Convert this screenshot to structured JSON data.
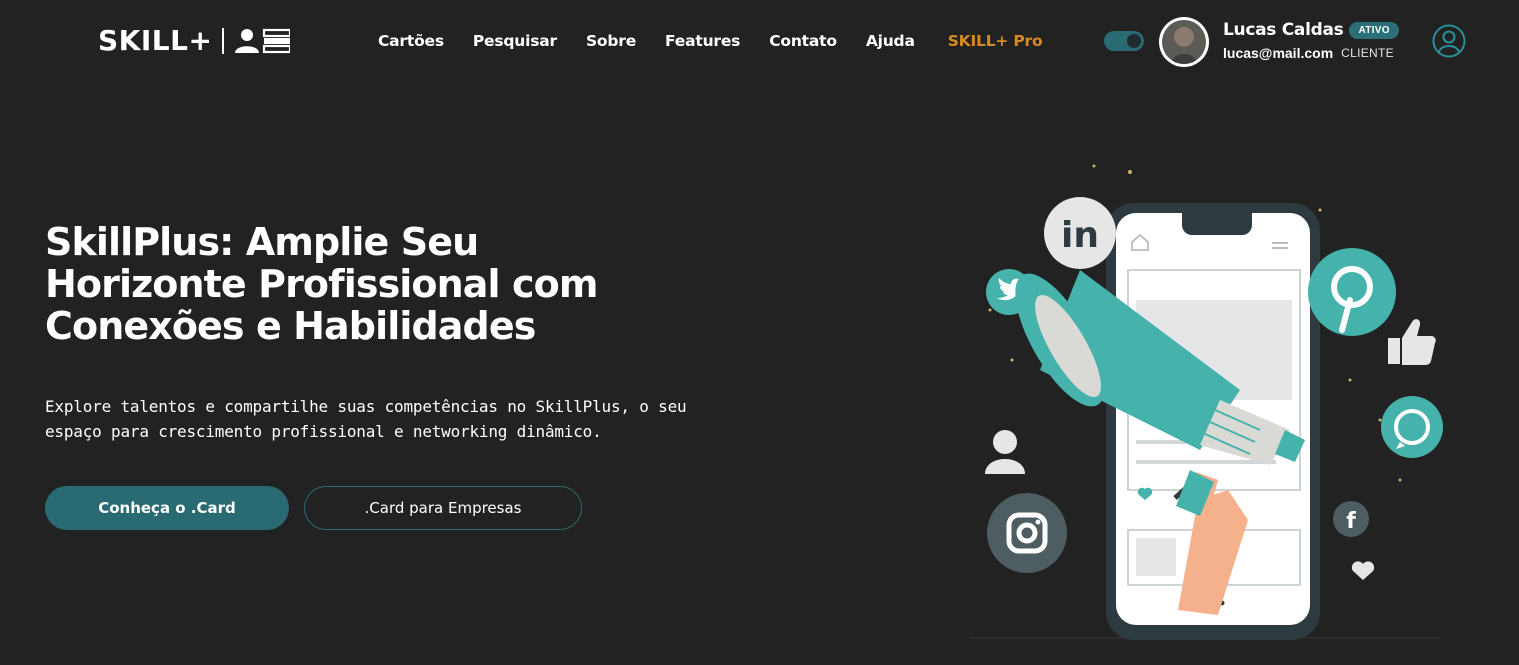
{
  "header": {
    "logo": {
      "text": "SKILL+",
      "icon": "id-card-icon"
    },
    "nav": [
      {
        "label": "Cartões"
      },
      {
        "label": "Pesquisar"
      },
      {
        "label": "Sobre"
      },
      {
        "label": "Features"
      },
      {
        "label": "Contato"
      },
      {
        "label": "Ajuda"
      },
      {
        "label": "SKILL+ Pro",
        "accent": "#d98a1e"
      }
    ],
    "theme_toggle": {
      "on": true
    },
    "user": {
      "name": "Lucas Caldas",
      "status": "ATIVO",
      "email": "lucas@mail.com",
      "role": "CLIENTE"
    },
    "account_icon": "user-circle-icon"
  },
  "hero": {
    "title": "SkillPlus: Amplie Seu Horizonte Profissional com Conexões e Habilidades",
    "description": "Explore talentos e compartilhe suas competências no SkillPlus, o seu espaço para crescimento profissional e networking dinâmico.",
    "primary_button": "Conheça o .Card",
    "secondary_button": ".Card para Empresas",
    "illustration_icons": [
      "linkedin-icon",
      "twitter-icon",
      "pinterest-icon",
      "thumbs-up-icon",
      "whatsapp-icon",
      "user-icon",
      "instagram-icon",
      "facebook-icon",
      "heart-icon",
      "megaphone-icon",
      "phone-icon"
    ]
  },
  "colors": {
    "background": "#222222",
    "accent": "#2a6a73",
    "pro": "#d98a1e",
    "teal": "#45b2ab"
  }
}
